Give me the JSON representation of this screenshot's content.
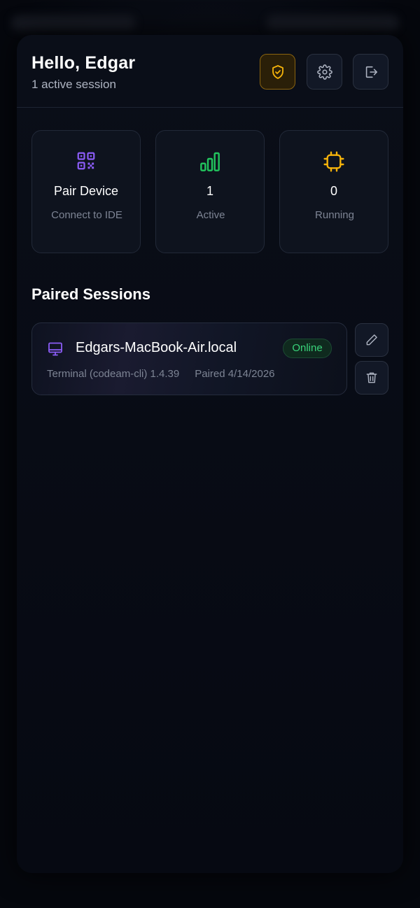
{
  "header": {
    "greeting": "Hello, Edgar",
    "subtitle": "1 active session",
    "icons": [
      "shield-check-icon",
      "gear-icon",
      "logout-icon"
    ]
  },
  "stats": [
    {
      "icon": "qr-code-icon",
      "value": "Pair Device",
      "label": "Connect to IDE",
      "color": "#8b5cf6"
    },
    {
      "icon": "signal-bars-icon",
      "value": "1",
      "label": "Active",
      "color": "#22c55e"
    },
    {
      "icon": "cpu-chip-icon",
      "value": "0",
      "label": "Running",
      "color": "#f5b30b"
    }
  ],
  "sessions": {
    "title": "Paired Sessions",
    "items": [
      {
        "name": "Edgars-MacBook-Air.local",
        "status": "Online",
        "client": "Terminal (codeam-cli) 1.4.39",
        "paired": "Paired 4/14/2026"
      }
    ]
  },
  "colors": {
    "accent_purple": "#8b5cf6",
    "accent_green": "#22c55e",
    "accent_amber": "#f5b30b",
    "background": "#05070d"
  }
}
